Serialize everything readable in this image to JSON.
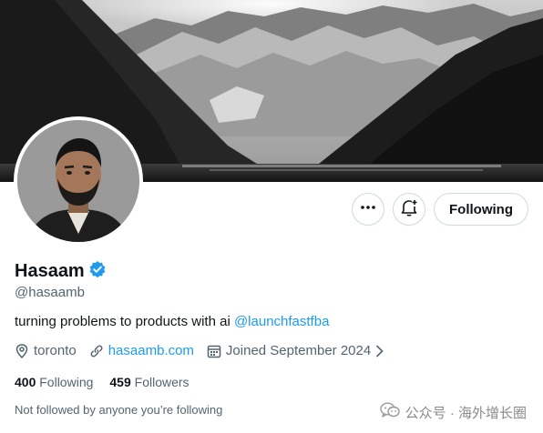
{
  "profile": {
    "name": "Hasaam",
    "handle": "@hasaamb",
    "bio_text": "turning problems to products with ai ",
    "bio_mention": "@launchfastfba",
    "location": "toronto",
    "website": "hasaamb.com",
    "joined": "Joined September 2024",
    "following_count": "400",
    "following_label": "Following",
    "followers_count": "459",
    "followers_label": "Followers",
    "not_followed": "Not followed by anyone you’re following"
  },
  "actions": {
    "more_icon": "more-horizontal-icon",
    "notify_icon": "bell-plus-icon",
    "follow_label": "Following"
  },
  "icons": {
    "verified": "verified-badge-icon",
    "location": "location-pin-icon",
    "link": "link-icon",
    "calendar": "calendar-icon",
    "chevron": "chevron-right-icon"
  },
  "watermark": {
    "text": "公众号 · 海外增长圈"
  },
  "colors": {
    "accent": "#1d9bf0",
    "secondary_text": "#536471",
    "primary_text": "#0f1419",
    "border": "#cfd9de"
  }
}
